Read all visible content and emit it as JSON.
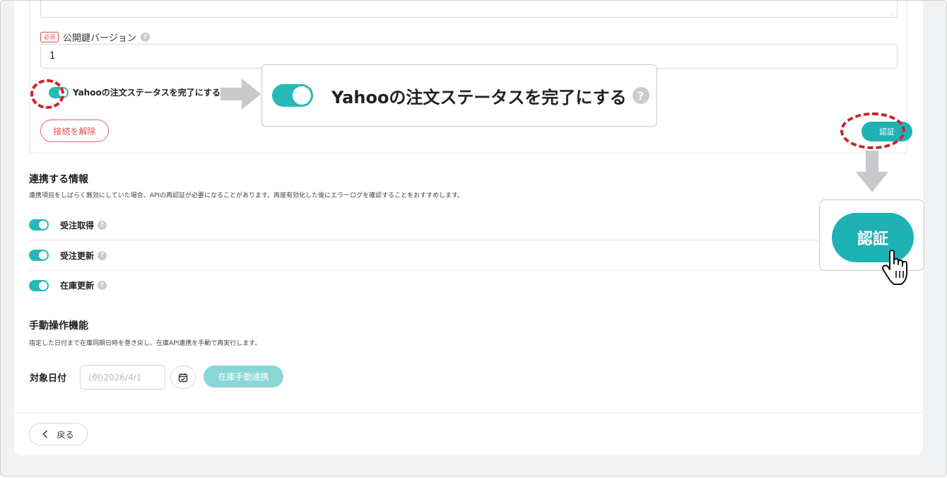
{
  "connection": {
    "required_badge": "必須",
    "key_version_label": "公開鍵バージョン",
    "key_version_value": "1",
    "complete_status_label": "Yahooの注文ステータスを完了にする",
    "disconnect_label": "接続を解除",
    "auth_label": "認証"
  },
  "zoom": {
    "complete_status_label": "Yahooの注文ステータスを完了にする",
    "auth_label": "認証"
  },
  "sync_info": {
    "title": "連携する情報",
    "description": "連携項目をしばらく無効にしていた場合、APIの再認証が必要になることがあります。再度有効化した後にエラーログを確認することをおすすめします。",
    "items": [
      {
        "label": "受注取得",
        "enabled": true
      },
      {
        "label": "受注更新",
        "enabled": true
      },
      {
        "label": "在庫更新",
        "enabled": true
      }
    ]
  },
  "manual": {
    "title": "手動操作機能",
    "description": "指定した日付まで在庫同期日時を巻き戻し、在庫API連携を手動で再実行します。",
    "date_label": "対象日付",
    "date_placeholder": "(例)2026/4/1",
    "sync_button": "在庫手動連携"
  },
  "footer": {
    "back_label": "戻る"
  },
  "help_glyph": "?",
  "resize_glyph": "⋰",
  "colors": {
    "accent": "#1fb2b5",
    "toggle_on": "#28b8b8",
    "danger": "#e04c4c",
    "annotation_ring": "#c9252c",
    "annotation_arrow": "#c7c9cd"
  }
}
